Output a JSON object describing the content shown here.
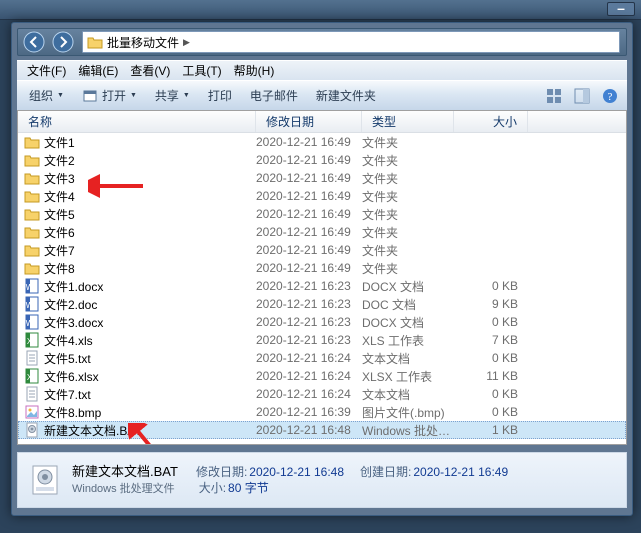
{
  "titlebar": {
    "min": "–"
  },
  "nav": {
    "path": "批量移动文件"
  },
  "menu": {
    "file": "文件(F)",
    "edit": "编辑(E)",
    "view": "查看(V)",
    "tools": "工具(T)",
    "help": "帮助(H)"
  },
  "toolbar": {
    "organize": "组织",
    "open": "打开",
    "share": "共享",
    "print": "打印",
    "email": "电子邮件",
    "newfolder": "新建文件夹"
  },
  "columns": {
    "name": "名称",
    "date": "修改日期",
    "type": "类型",
    "size": "大小"
  },
  "rows": [
    {
      "icon": "folder",
      "name": "文件1",
      "date": "2020-12-21 16:49",
      "type": "文件夹",
      "size": ""
    },
    {
      "icon": "folder",
      "name": "文件2",
      "date": "2020-12-21 16:49",
      "type": "文件夹",
      "size": ""
    },
    {
      "icon": "folder",
      "name": "文件3",
      "date": "2020-12-21 16:49",
      "type": "文件夹",
      "size": ""
    },
    {
      "icon": "folder",
      "name": "文件4",
      "date": "2020-12-21 16:49",
      "type": "文件夹",
      "size": ""
    },
    {
      "icon": "folder",
      "name": "文件5",
      "date": "2020-12-21 16:49",
      "type": "文件夹",
      "size": ""
    },
    {
      "icon": "folder",
      "name": "文件6",
      "date": "2020-12-21 16:49",
      "type": "文件夹",
      "size": ""
    },
    {
      "icon": "folder",
      "name": "文件7",
      "date": "2020-12-21 16:49",
      "type": "文件夹",
      "size": ""
    },
    {
      "icon": "folder",
      "name": "文件8",
      "date": "2020-12-21 16:49",
      "type": "文件夹",
      "size": ""
    },
    {
      "icon": "docx",
      "name": "文件1.docx",
      "date": "2020-12-21 16:23",
      "type": "DOCX 文档",
      "size": "0 KB"
    },
    {
      "icon": "doc",
      "name": "文件2.doc",
      "date": "2020-12-21 16:23",
      "type": "DOC 文档",
      "size": "9 KB"
    },
    {
      "icon": "docx",
      "name": "文件3.docx",
      "date": "2020-12-21 16:23",
      "type": "DOCX 文档",
      "size": "0 KB"
    },
    {
      "icon": "xls",
      "name": "文件4.xls",
      "date": "2020-12-21 16:23",
      "type": "XLS 工作表",
      "size": "7 KB"
    },
    {
      "icon": "txt",
      "name": "文件5.txt",
      "date": "2020-12-21 16:24",
      "type": "文本文档",
      "size": "0 KB"
    },
    {
      "icon": "xlsx",
      "name": "文件6.xlsx",
      "date": "2020-12-21 16:24",
      "type": "XLSX 工作表",
      "size": "11 KB"
    },
    {
      "icon": "txt",
      "name": "文件7.txt",
      "date": "2020-12-21 16:24",
      "type": "文本文档",
      "size": "0 KB"
    },
    {
      "icon": "bmp",
      "name": "文件8.bmp",
      "date": "2020-12-21 16:39",
      "type": "图片文件(.bmp)",
      "size": "0 KB"
    },
    {
      "icon": "bat",
      "name": "新建文本文档.BAT",
      "date": "2020-12-21 16:48",
      "type": "Windows 批处理...",
      "size": "1 KB",
      "selected": true
    }
  ],
  "details": {
    "name": "新建文本文档.BAT",
    "typeline": "Windows 批处理文件",
    "k_mod": "修改日期:",
    "v_mod": "2020-12-21 16:48",
    "k_create": "创建日期:",
    "v_create": "2020-12-21 16:49",
    "k_size": "大小:",
    "v_size": "80 字节"
  }
}
